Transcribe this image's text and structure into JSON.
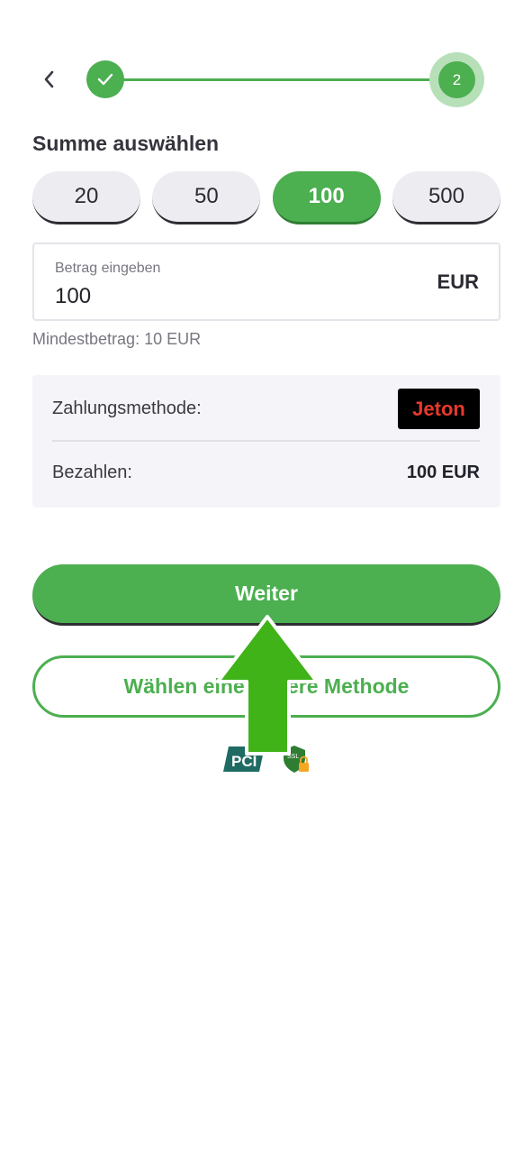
{
  "stepper": {
    "step2_label": "2"
  },
  "title": "Summe auswählen",
  "chips": [
    {
      "label": "20",
      "selected": false
    },
    {
      "label": "50",
      "selected": false
    },
    {
      "label": "100",
      "selected": true
    },
    {
      "label": "500",
      "selected": false
    }
  ],
  "amount": {
    "label": "Betrag eingeben",
    "value": "100",
    "currency": "EUR"
  },
  "min_note": "Mindestbetrag: 10 EUR",
  "summary": {
    "payment_method_label": "Zahlungsmethode:",
    "payment_method_logo": "Jeton",
    "pay_label": "Bezahlen:",
    "pay_value": "100 EUR"
  },
  "buttons": {
    "continue": "Weiter",
    "other_method": "Wählen eine andere Methode"
  },
  "badges": {
    "pci": "PCI",
    "ssl": "SSL"
  },
  "colors": {
    "accent": "#4caf50",
    "chip_bg": "#ececf1",
    "jeton_red": "#e8392a"
  }
}
